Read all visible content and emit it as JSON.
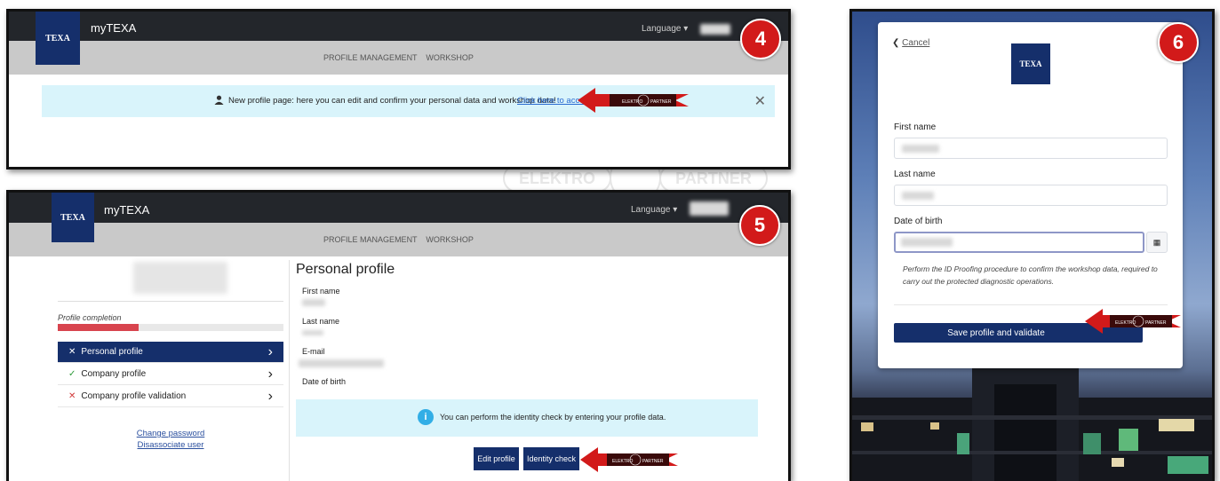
{
  "panel4": {
    "badge": "4",
    "logo_text": "TEXA",
    "app_title": "myTEXA",
    "language_label": "Language",
    "nav": [
      "PROFILE MANAGEMENT",
      "WORKSHOP"
    ],
    "banner_text": "New profile page: here you can edit and confirm your personal data and workshop data!",
    "banner_link": "Click here to access"
  },
  "panel5": {
    "badge": "5",
    "logo_text": "TEXA",
    "app_title": "myTEXA",
    "language_label": "Language",
    "nav": [
      "PROFILE MANAGEMENT",
      "WORKSHOP"
    ],
    "profile_completion_label": "Profile completion",
    "profile_completion_fraction": 0.36,
    "sidebar_items": [
      {
        "mark": "✕",
        "label": "Personal profile",
        "active": true,
        "mark_color": "#ffffff"
      },
      {
        "mark": "✓",
        "label": "Company profile",
        "active": false,
        "mark_color": "#2e9a3a"
      },
      {
        "mark": "✕",
        "label": "Company profile validation",
        "active": false,
        "mark_color": "#d13a3a"
      }
    ],
    "change_password": "Change password",
    "disassociate_user": "Disassociate user",
    "heading": "Personal profile",
    "fields": [
      "First name",
      "Last name",
      "E-mail",
      "Date of birth"
    ],
    "info_text": "You can perform the identity check by entering your profile data.",
    "edit_button": "Edit profile",
    "identity_button": "Identity check"
  },
  "panel6": {
    "badge": "6",
    "cancel_label": "Cancel",
    "logo_text": "TEXA",
    "first_name_label": "First name",
    "last_name_label": "Last name",
    "dob_label": "Date of birth",
    "note": "Perform the ID Proofing procedure to confirm the workshop data, required to carry out the protected diagnostic operations.",
    "save_button": "Save profile and validate"
  },
  "arrow_badge": {
    "left": "ELEKTRO",
    "right": "PARTNER"
  },
  "watermark": {
    "left": "ELEKTRO",
    "right": "PARTNER"
  },
  "colors": {
    "navy": "#152f6b",
    "badge_red": "#d21a1a",
    "banner_bg": "#d9f4fb",
    "progress_red": "#d8444e"
  }
}
